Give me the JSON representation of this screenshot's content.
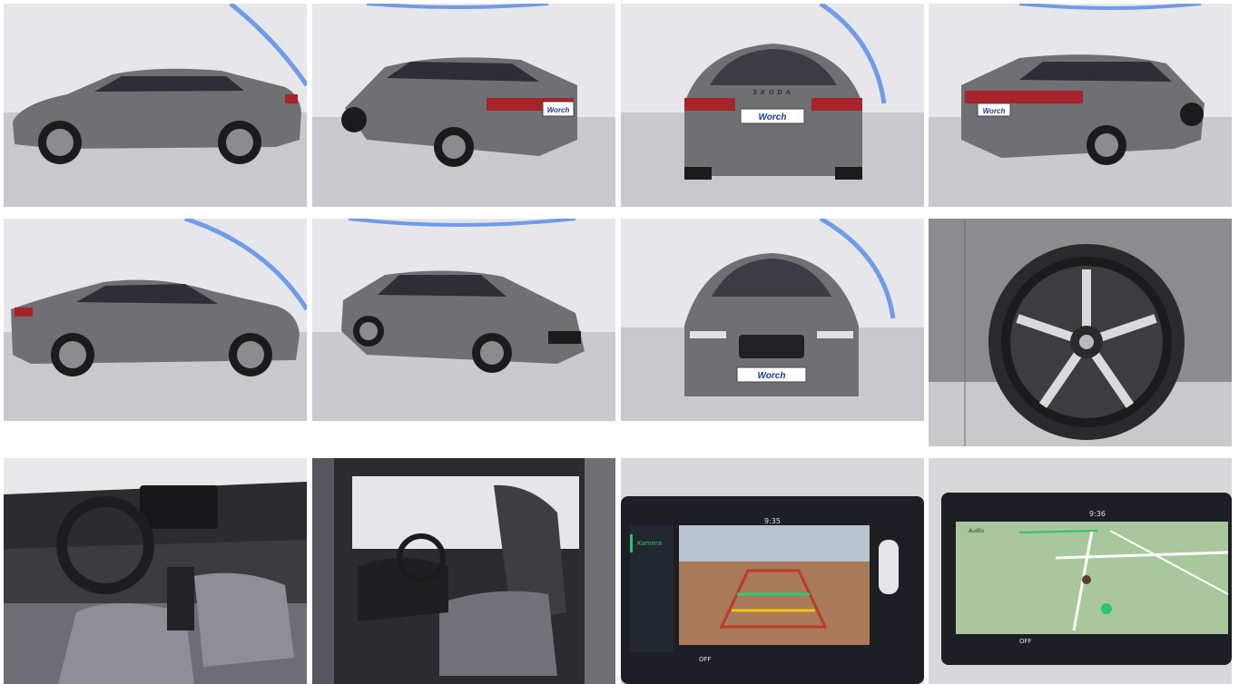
{
  "gallery": {
    "photos": [
      {
        "name": "photo-side-left",
        "label": "Exterior left side view",
        "caption": "",
        "plate": ""
      },
      {
        "name": "photo-rear-three-quarter-left",
        "label": "Rear three-quarter left view",
        "plate": "Worch"
      },
      {
        "name": "photo-rear",
        "label": "Rear view",
        "plate": "Worch",
        "badge": "SKODA"
      },
      {
        "name": "photo-rear-three-quarter-right",
        "label": "Rear three-quarter right view",
        "plate": "Worch"
      },
      {
        "name": "photo-side-right",
        "label": "Exterior right side view"
      },
      {
        "name": "photo-front-three-quarter",
        "label": "Front three-quarter view"
      },
      {
        "name": "photo-front",
        "label": "Front view",
        "plate": "Worch"
      },
      {
        "name": "photo-wheel",
        "label": "Alloy wheel close-up"
      },
      {
        "name": "photo-interior-dashboard",
        "label": "Interior dashboard"
      },
      {
        "name": "photo-interior-seats",
        "label": "Interior front seats"
      },
      {
        "name": "photo-camera-screen",
        "label": "Infotainment rear camera",
        "screen_time": "9:35",
        "screen_tab": "Kamera",
        "screen_off": "OFF"
      },
      {
        "name": "photo-nav-screen",
        "label": "Infotainment navigation",
        "screen_time": "9:36",
        "screen_tab": "Audio",
        "screen_off": "OFF"
      }
    ]
  },
  "colors": {
    "car_body": "#6e7074",
    "studio_wall": "#e6e6ea",
    "studio_floor": "#c9c9ce",
    "neon_strip": "#6f9be8",
    "tail_light": "#a8232a",
    "screen_bg": "#1c1f24",
    "screen_accent": "#2ec46b"
  }
}
